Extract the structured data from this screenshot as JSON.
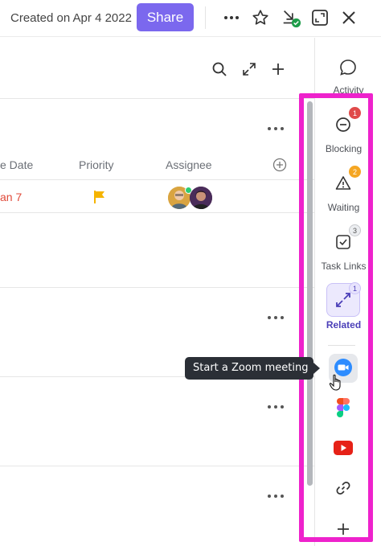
{
  "header": {
    "created_text": "Created on Apr 4 2022",
    "share_label": "Share",
    "icons": [
      "more-dots-icon",
      "star-icon",
      "download-check-icon",
      "expand-icon",
      "close-icon"
    ]
  },
  "main": {
    "toolbar_icons": [
      "search-icon",
      "collapse-icon",
      "plus-icon"
    ],
    "columns": {
      "due_date": "e Date",
      "priority": "Priority",
      "assignee": "Assignee"
    },
    "task_row": {
      "due_date": "an 7",
      "priority_color": "#f5b400"
    }
  },
  "tooltip": {
    "text": "Start a Zoom meeting"
  },
  "sidebar": {
    "activity_label": "Activity",
    "items": [
      {
        "label": "Blocking",
        "badge": "1",
        "badge_color": "#e04a4a",
        "icon": "minus-circle-icon"
      },
      {
        "label": "Waiting",
        "badge": "2",
        "badge_color": "#f5a623",
        "icon": "warning-icon"
      },
      {
        "label": "Task Links",
        "badge": "3",
        "badge_color": "#c7c9cd",
        "icon": "checkbox-icon"
      },
      {
        "label": "Related",
        "badge": "1",
        "badge_color": "#c9c1f7",
        "icon": "related-arrows-icon"
      }
    ],
    "apps": [
      "zoom-icon",
      "figma-icon",
      "youtube-icon",
      "link-icon",
      "plus-icon"
    ]
  },
  "colors": {
    "accent": "#7b68ee",
    "highlight": "#ee22cc",
    "zoom_blue": "#2d8cff",
    "youtube_red": "#e62117"
  }
}
